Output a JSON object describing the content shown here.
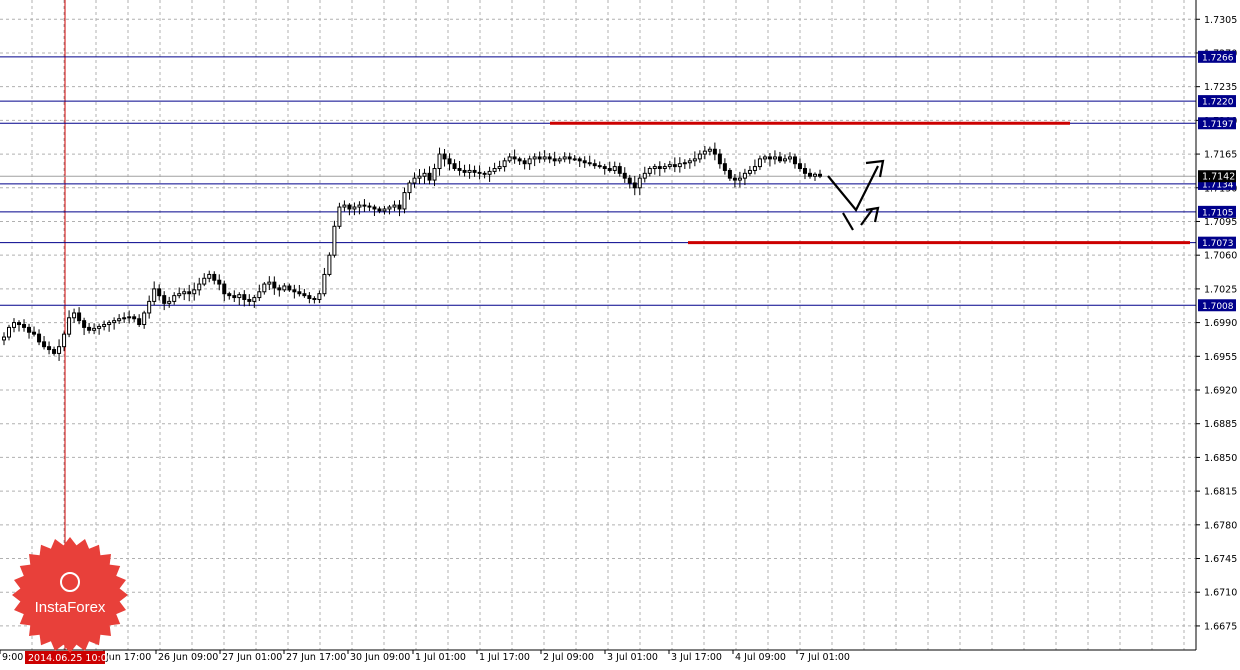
{
  "chart_data": {
    "type": "candlestick",
    "instrument": "",
    "ylim": [
      1.665,
      1.7325
    ],
    "y_ticks": [
      "1.7305",
      "1.7270",
      "1.7235",
      "1.7200",
      "1.7165",
      "1.7130",
      "1.7095",
      "1.7060",
      "1.7025",
      "1.6990",
      "1.6955",
      "1.6920",
      "1.6885",
      "1.6850",
      "1.6815",
      "1.6780",
      "1.6745",
      "1.6710",
      "1.6675"
    ],
    "x_ticks": [
      "9:00",
      "Jun 17:00",
      "26 Jun 09:00",
      "27 Jun 01:00",
      "27 Jun 17:00",
      "30 Jun 09:00",
      "1 Jul 01:00",
      "1 Jul 17:00",
      "2 Jul 09:00",
      "3 Jul 01:00",
      "3 Jul 17:00",
      "4 Jul 09:00",
      "7 Jul 01:00"
    ],
    "highlight_time_label": "2014.06.25 10:00",
    "horizontal_levels": [
      {
        "label": "1.7266",
        "value": 1.7266,
        "color": "#00008b"
      },
      {
        "label": "1.7220",
        "value": 1.722,
        "color": "#00008b"
      },
      {
        "label": "1.7197",
        "value": 1.7197,
        "color": "#00008b"
      },
      {
        "label": "1.7134",
        "value": 1.7134,
        "color": "#00008b"
      },
      {
        "label": "1.7105",
        "value": 1.7105,
        "color": "#00008b"
      },
      {
        "label": "1.7073",
        "value": 1.7073,
        "color": "#00008b"
      },
      {
        "label": "1.7008",
        "value": 1.7008,
        "color": "#00008b"
      }
    ],
    "current_price": {
      "label": "1.7142",
      "value": 1.7142
    },
    "resistance_line": {
      "value": 1.7197,
      "color": "#cc0000"
    },
    "support_line": {
      "value": 1.7073,
      "color": "#cc0000"
    },
    "close_series": [
      1.6975,
      1.6985,
      1.699,
      1.6988,
      1.6985,
      1.698,
      1.6978,
      1.697,
      1.6965,
      1.6962,
      1.6958,
      1.6965,
      1.6978,
      1.6995,
      1.7,
      1.6992,
      1.6985,
      1.6982,
      1.6984,
      1.6986,
      1.6988,
      1.699,
      1.6992,
      1.6994,
      1.6995,
      1.6996,
      1.6994,
      1.6988,
      1.7,
      1.7012,
      1.7025,
      1.7018,
      1.701,
      1.7012,
      1.7018,
      1.702,
      1.7022,
      1.702,
      1.7024,
      1.703,
      1.7036,
      1.704,
      1.7034,
      1.703,
      1.702,
      1.7018,
      1.7016,
      1.7019,
      1.7014,
      1.7012,
      1.7016,
      1.7022,
      1.703,
      1.7032,
      1.7026,
      1.7024,
      1.7028,
      1.7024,
      1.7022,
      1.702,
      1.7018,
      1.7015,
      1.7014,
      1.702,
      1.704,
      1.706,
      1.709,
      1.711,
      1.7112,
      1.7108,
      1.711,
      1.7112,
      1.7111,
      1.711,
      1.7108,
      1.7106,
      1.7108,
      1.711,
      1.7112,
      1.7108,
      1.7125,
      1.7135,
      1.714,
      1.7142,
      1.7145,
      1.7138,
      1.715,
      1.7165,
      1.716,
      1.7155,
      1.715,
      1.7148,
      1.7146,
      1.7148,
      1.7146,
      1.7145,
      1.7144,
      1.7147,
      1.715,
      1.7152,
      1.7158,
      1.7162,
      1.716,
      1.7158,
      1.7155,
      1.716,
      1.7162,
      1.716,
      1.7162,
      1.716,
      1.7158,
      1.716,
      1.7162,
      1.716,
      1.716,
      1.7158,
      1.7156,
      1.7155,
      1.7153,
      1.7152,
      1.715,
      1.7148,
      1.7152,
      1.7145,
      1.714,
      1.7135,
      1.713,
      1.714,
      1.7145,
      1.715,
      1.7152,
      1.715,
      1.7152,
      1.7154,
      1.7152,
      1.7155,
      1.7156,
      1.7158,
      1.716,
      1.7165,
      1.7168,
      1.717,
      1.7165,
      1.7155,
      1.7148,
      1.714,
      1.7138,
      1.714,
      1.7145,
      1.7148,
      1.7152,
      1.716,
      1.7162,
      1.716,
      1.7162,
      1.7158,
      1.716,
      1.7162,
      1.7155,
      1.715,
      1.7145,
      1.7142,
      1.7144,
      1.7142
    ]
  }
}
